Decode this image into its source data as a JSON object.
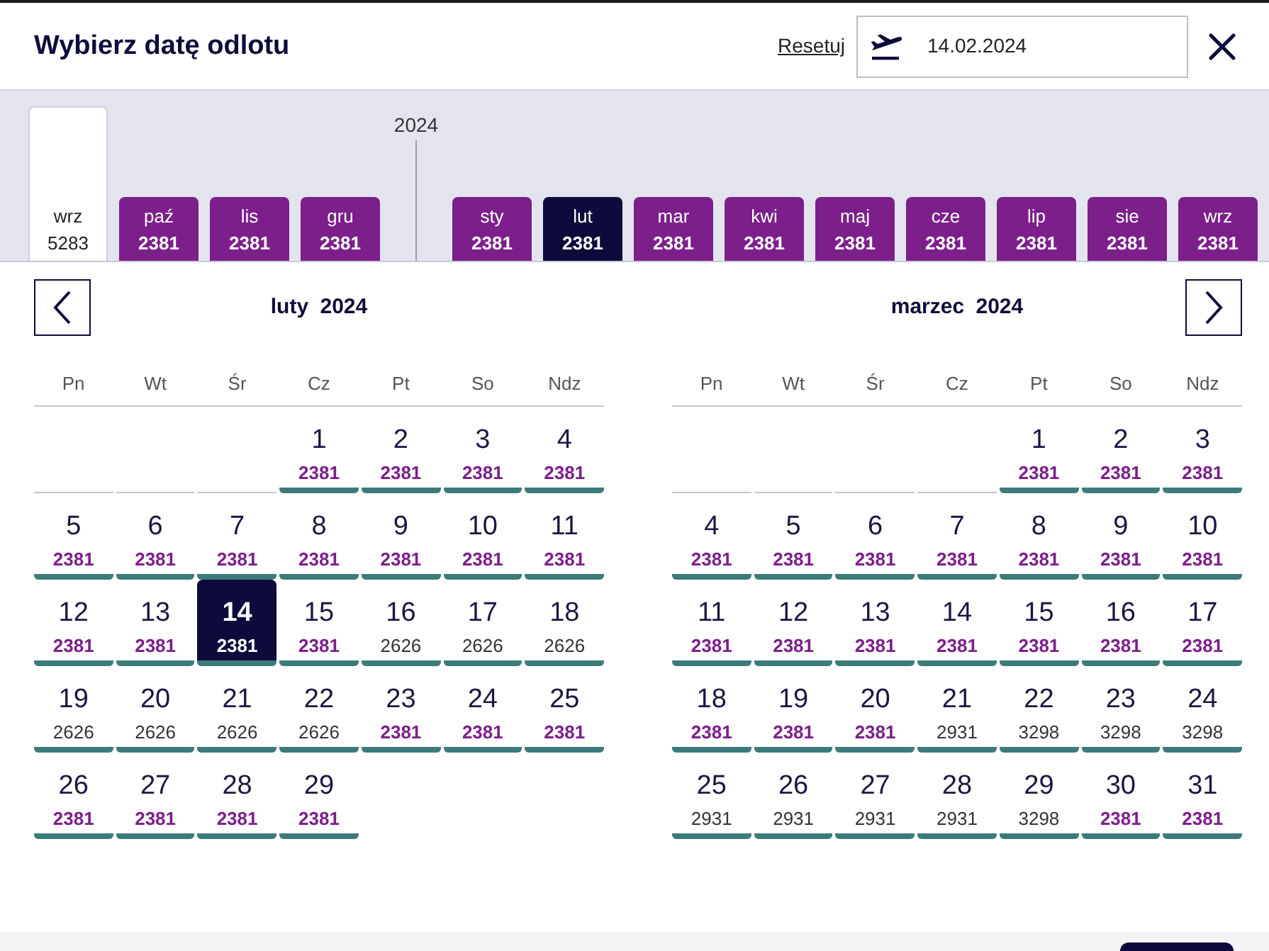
{
  "header": {
    "title": "Wybierz datę odlotu",
    "reset_link": "Resetuj",
    "date_field": {
      "value": "14.02.2024"
    }
  },
  "month_bar": {
    "groups": [
      {
        "months": [
          {
            "label": "wrz",
            "price": "5283",
            "lowest_price": false,
            "selected": false
          },
          {
            "label": "paź",
            "price": "2381",
            "lowest_price": true,
            "selected": false
          },
          {
            "label": "lis",
            "price": "2381",
            "lowest_price": true,
            "selected": false
          },
          {
            "label": "gru",
            "price": "2381",
            "lowest_price": true,
            "selected": false
          }
        ]
      },
      {
        "year": "2024",
        "months": [
          {
            "label": "sty",
            "price": "2381",
            "lowest_price": true,
            "selected": false
          },
          {
            "label": "lut",
            "price": "2381",
            "lowest_price": true,
            "selected": true
          },
          {
            "label": "mar",
            "price": "2381",
            "lowest_price": true,
            "selected": false
          },
          {
            "label": "kwi",
            "price": "2381",
            "lowest_price": true,
            "selected": false
          },
          {
            "label": "maj",
            "price": "2381",
            "lowest_price": true,
            "selected": false
          },
          {
            "label": "cze",
            "price": "2381",
            "lowest_price": true,
            "selected": false
          },
          {
            "label": "lip",
            "price": "2381",
            "lowest_price": true,
            "selected": false
          },
          {
            "label": "sie",
            "price": "2381",
            "lowest_price": true,
            "selected": false
          },
          {
            "label": "wrz",
            "price": "2381",
            "lowest_price": true,
            "selected": false
          }
        ]
      }
    ]
  },
  "calendars": [
    {
      "title": "luty 2024",
      "prev_button": true,
      "weekdays": [
        "Pn",
        "Wt",
        "Śr",
        "Cz",
        "Pt",
        "So",
        "Ndz"
      ],
      "weeks": [
        [
          {
            "kind": "blank"
          },
          {
            "kind": "blank"
          },
          {
            "kind": "blank"
          },
          {
            "kind": "day",
            "day": "1",
            "price": "2381",
            "lowest_price": true,
            "selected": false
          },
          {
            "kind": "day",
            "day": "2",
            "price": "2381",
            "lowest_price": true,
            "selected": false
          },
          {
            "kind": "day",
            "day": "3",
            "price": "2381",
            "lowest_price": true,
            "selected": false
          },
          {
            "kind": "day",
            "day": "4",
            "price": "2381",
            "lowest_price": true,
            "selected": false
          }
        ],
        [
          {
            "kind": "day",
            "day": "5",
            "price": "2381",
            "lowest_price": true,
            "selected": false
          },
          {
            "kind": "day",
            "day": "6",
            "price": "2381",
            "lowest_price": true,
            "selected": false
          },
          {
            "kind": "day",
            "day": "7",
            "price": "2381",
            "lowest_price": true,
            "selected": false
          },
          {
            "kind": "day",
            "day": "8",
            "price": "2381",
            "lowest_price": true,
            "selected": false
          },
          {
            "kind": "day",
            "day": "9",
            "price": "2381",
            "lowest_price": true,
            "selected": false
          },
          {
            "kind": "day",
            "day": "10",
            "price": "2381",
            "lowest_price": true,
            "selected": false
          },
          {
            "kind": "day",
            "day": "11",
            "price": "2381",
            "lowest_price": true,
            "selected": false
          }
        ],
        [
          {
            "kind": "day",
            "day": "12",
            "price": "2381",
            "lowest_price": true,
            "selected": false
          },
          {
            "kind": "day",
            "day": "13",
            "price": "2381",
            "lowest_price": true,
            "selected": false
          },
          {
            "kind": "day",
            "day": "14",
            "price": "2381",
            "lowest_price": true,
            "selected": true
          },
          {
            "kind": "day",
            "day": "15",
            "price": "2381",
            "lowest_price": true,
            "selected": false
          },
          {
            "kind": "day",
            "day": "16",
            "price": "2626",
            "lowest_price": false,
            "selected": false
          },
          {
            "kind": "day",
            "day": "17",
            "price": "2626",
            "lowest_price": false,
            "selected": false
          },
          {
            "kind": "day",
            "day": "18",
            "price": "2626",
            "lowest_price": false,
            "selected": false
          }
        ],
        [
          {
            "kind": "day",
            "day": "19",
            "price": "2626",
            "lowest_price": false,
            "selected": false
          },
          {
            "kind": "day",
            "day": "20",
            "price": "2626",
            "lowest_price": false,
            "selected": false
          },
          {
            "kind": "day",
            "day": "21",
            "price": "2626",
            "lowest_price": false,
            "selected": false
          },
          {
            "kind": "day",
            "day": "22",
            "price": "2626",
            "lowest_price": false,
            "selected": false
          },
          {
            "kind": "day",
            "day": "23",
            "price": "2381",
            "lowest_price": true,
            "selected": false
          },
          {
            "kind": "day",
            "day": "24",
            "price": "2381",
            "lowest_price": true,
            "selected": false
          },
          {
            "kind": "day",
            "day": "25",
            "price": "2381",
            "lowest_price": true,
            "selected": false
          }
        ],
        [
          {
            "kind": "day",
            "day": "26",
            "price": "2381",
            "lowest_price": true,
            "selected": false
          },
          {
            "kind": "day",
            "day": "27",
            "price": "2381",
            "lowest_price": true,
            "selected": false
          },
          {
            "kind": "day",
            "day": "28",
            "price": "2381",
            "lowest_price": true,
            "selected": false
          },
          {
            "kind": "day",
            "day": "29",
            "price": "2381",
            "lowest_price": true,
            "selected": false
          }
        ]
      ]
    },
    {
      "title": "marzec 2024",
      "next_button": true,
      "weekdays": [
        "Pn",
        "Wt",
        "Śr",
        "Cz",
        "Pt",
        "So",
        "Ndz"
      ],
      "weeks": [
        [
          {
            "kind": "blank"
          },
          {
            "kind": "blank"
          },
          {
            "kind": "blank"
          },
          {
            "kind": "blank"
          },
          {
            "kind": "day",
            "day": "1",
            "price": "2381",
            "lowest_price": true,
            "selected": false
          },
          {
            "kind": "day",
            "day": "2",
            "price": "2381",
            "lowest_price": true,
            "selected": false
          },
          {
            "kind": "day",
            "day": "3",
            "price": "2381",
            "lowest_price": true,
            "selected": false
          }
        ],
        [
          {
            "kind": "day",
            "day": "4",
            "price": "2381",
            "lowest_price": true,
            "selected": false
          },
          {
            "kind": "day",
            "day": "5",
            "price": "2381",
            "lowest_price": true,
            "selected": false
          },
          {
            "kind": "day",
            "day": "6",
            "price": "2381",
            "lowest_price": true,
            "selected": false
          },
          {
            "kind": "day",
            "day": "7",
            "price": "2381",
            "lowest_price": true,
            "selected": false
          },
          {
            "kind": "day",
            "day": "8",
            "price": "2381",
            "lowest_price": true,
            "selected": false
          },
          {
            "kind": "day",
            "day": "9",
            "price": "2381",
            "lowest_price": true,
            "selected": false
          },
          {
            "kind": "day",
            "day": "10",
            "price": "2381",
            "lowest_price": true,
            "selected": false
          }
        ],
        [
          {
            "kind": "day",
            "day": "11",
            "price": "2381",
            "lowest_price": true,
            "selected": false
          },
          {
            "kind": "day",
            "day": "12",
            "price": "2381",
            "lowest_price": true,
            "selected": false
          },
          {
            "kind": "day",
            "day": "13",
            "price": "2381",
            "lowest_price": true,
            "selected": false
          },
          {
            "kind": "day",
            "day": "14",
            "price": "2381",
            "lowest_price": true,
            "selected": false
          },
          {
            "kind": "day",
            "day": "15",
            "price": "2381",
            "lowest_price": true,
            "selected": false
          },
          {
            "kind": "day",
            "day": "16",
            "price": "2381",
            "lowest_price": true,
            "selected": false
          },
          {
            "kind": "day",
            "day": "17",
            "price": "2381",
            "lowest_price": true,
            "selected": false
          }
        ],
        [
          {
            "kind": "day",
            "day": "18",
            "price": "2381",
            "lowest_price": true,
            "selected": false
          },
          {
            "kind": "day",
            "day": "19",
            "price": "2381",
            "lowest_price": true,
            "selected": false
          },
          {
            "kind": "day",
            "day": "20",
            "price": "2381",
            "lowest_price": true,
            "selected": false
          },
          {
            "kind": "day",
            "day": "21",
            "price": "2931",
            "lowest_price": false,
            "selected": false
          },
          {
            "kind": "day",
            "day": "22",
            "price": "3298",
            "lowest_price": false,
            "selected": false
          },
          {
            "kind": "day",
            "day": "23",
            "price": "3298",
            "lowest_price": false,
            "selected": false
          },
          {
            "kind": "day",
            "day": "24",
            "price": "3298",
            "lowest_price": false,
            "selected": false
          }
        ],
        [
          {
            "kind": "day",
            "day": "25",
            "price": "2931",
            "lowest_price": false,
            "selected": false
          },
          {
            "kind": "day",
            "day": "26",
            "price": "2931",
            "lowest_price": false,
            "selected": false
          },
          {
            "kind": "day",
            "day": "27",
            "price": "2931",
            "lowest_price": false,
            "selected": false
          },
          {
            "kind": "day",
            "day": "28",
            "price": "2931",
            "lowest_price": false,
            "selected": false
          },
          {
            "kind": "day",
            "day": "29",
            "price": "3298",
            "lowest_price": false,
            "selected": false
          },
          {
            "kind": "day",
            "day": "30",
            "price": "2381",
            "lowest_price": true,
            "selected": false
          },
          {
            "kind": "day",
            "day": "31",
            "price": "2381",
            "lowest_price": true,
            "selected": false
          }
        ]
      ]
    }
  ]
}
